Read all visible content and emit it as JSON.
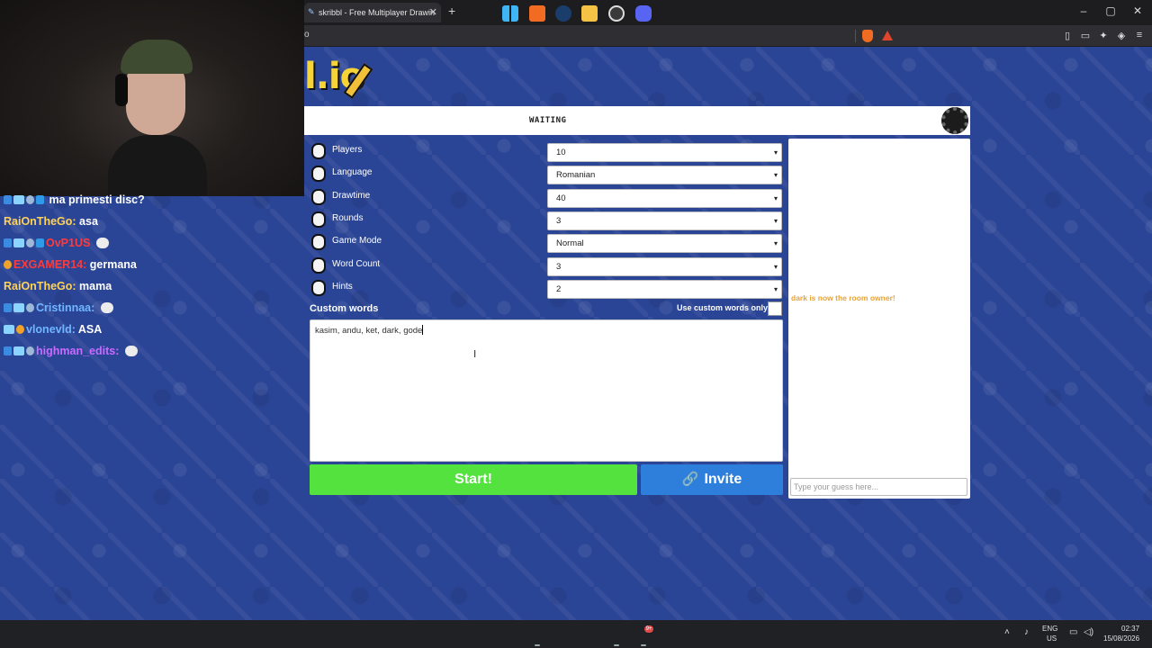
{
  "browser": {
    "tab_title": "skribbl - Free Multiplayer Drawin",
    "tab_close": "✕",
    "new_tab": "+",
    "address": "o",
    "window_minimize": "–",
    "window_maximize": "▢",
    "window_close": "✕"
  },
  "logo": {
    "text": "l.io"
  },
  "game": {
    "status": "WAITING",
    "settings": [
      {
        "label": "Players",
        "value": "10",
        "icon": "person-icon"
      },
      {
        "label": "Language",
        "value": "Romanian",
        "icon": "document-icon"
      },
      {
        "label": "Drawtime",
        "value": "40",
        "icon": "clock-icon"
      },
      {
        "label": "Rounds",
        "value": "3",
        "icon": "rounds-icon"
      },
      {
        "label": "Game Mode",
        "value": "Normal",
        "icon": "gamemode-icon"
      },
      {
        "label": "Word Count",
        "value": "3",
        "icon": "wordcount-icon"
      },
      {
        "label": "Hints",
        "value": "2",
        "icon": "question-icon"
      }
    ],
    "chevron": "▾",
    "custom_words_label": "Custom words",
    "use_custom_only_label": "Use custom words only",
    "custom_words_value": "kasim, andu, ket, dark, gode",
    "start_label": "Start!",
    "invite_label": "Invite",
    "owner_message": "dark is now the room owner!",
    "guess_placeholder": "Type your guess here..."
  },
  "stream_chat": [
    {
      "user": "",
      "message": "ma primesti disc?",
      "badges": [
        "b-sword",
        "b-rank",
        "b-gem",
        "b-blue"
      ]
    },
    {
      "user": "RaiOnTheGo:",
      "message": "asa",
      "badges": []
    },
    {
      "user": "OvP1US",
      "message": "",
      "badges": [
        "b-sword",
        "b-rank",
        "b-gem",
        "b-blue"
      ],
      "emote": true
    },
    {
      "user": "EXGAMER14:",
      "message": "germana",
      "badges": [
        "b-gold"
      ]
    },
    {
      "user": "RaiOnTheGo:",
      "message": "mama",
      "badges": []
    },
    {
      "user": "Cristinnaa:",
      "message": "",
      "badges": [
        "b-sword",
        "b-rank",
        "b-gem"
      ],
      "emote": true
    },
    {
      "user": "vlonevld:",
      "message": "ASA",
      "badges": [
        "b-rank",
        "b-gold"
      ]
    },
    {
      "user": "highman_edits:",
      "message": "",
      "badges": [
        "b-sword",
        "b-rank",
        "b-gem"
      ],
      "emote": true
    }
  ],
  "taskbar": {
    "discord_badge": "9+",
    "lang_top": "ENG",
    "lang_bottom": "US",
    "time": "02:37",
    "date": "15/08/2026"
  }
}
